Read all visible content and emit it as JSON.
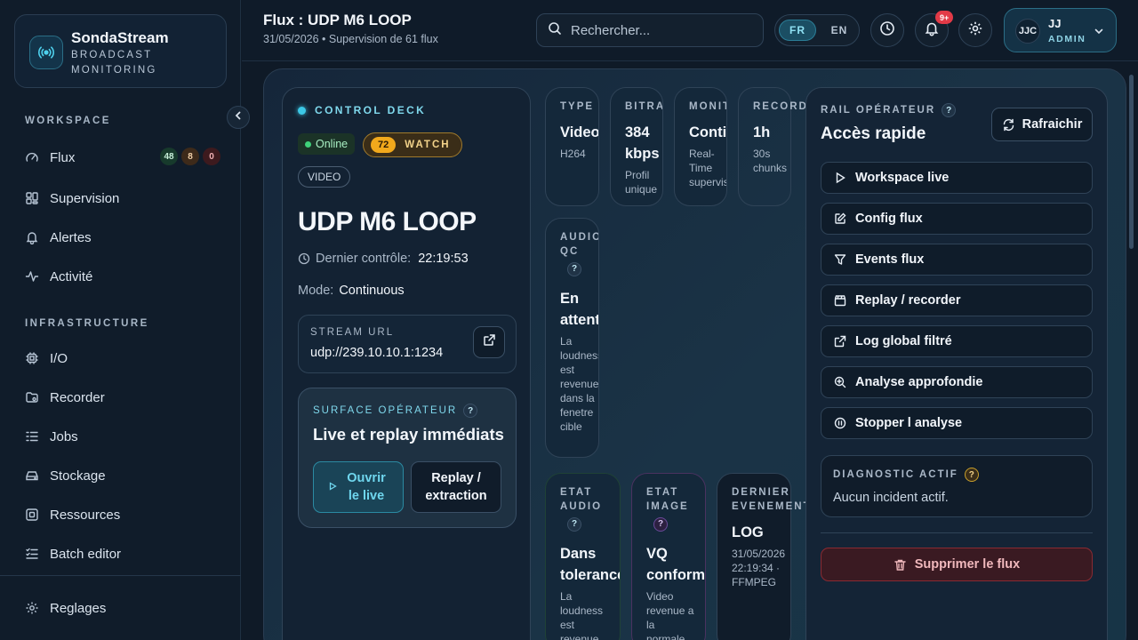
{
  "brand": {
    "name": "SondaStream",
    "subtitle": "BROADCAST MONITORING"
  },
  "sidebar": {
    "workspace_title": "WORKSPACE",
    "infrastructure_title": "INFRASTRUCTURE",
    "workspace_items": [
      {
        "label": "Flux",
        "icon": "gauge-icon"
      },
      {
        "label": "Supervision",
        "icon": "dashboard-icon"
      },
      {
        "label": "Alertes",
        "icon": "bell-icon"
      },
      {
        "label": "Activité",
        "icon": "activity-icon"
      }
    ],
    "flux_badges": {
      "ok": "48",
      "warn": "8",
      "crit": "0"
    },
    "infrastructure_items": [
      {
        "label": "I/O",
        "icon": "chip-icon"
      },
      {
        "label": "Recorder",
        "icon": "folder-icon"
      },
      {
        "label": "Jobs",
        "icon": "list-icon"
      },
      {
        "label": "Stockage",
        "icon": "drive-icon"
      },
      {
        "label": "Ressources",
        "icon": "cpu-icon"
      },
      {
        "label": "Batch editor",
        "icon": "checklist-icon"
      }
    ],
    "settings_label": "Reglages"
  },
  "header": {
    "title": "Flux : UDP M6 LOOP",
    "subtitle": "31/05/2026 • Supervision de 61 flux",
    "search_placeholder": "Rechercher...",
    "lang_active": "FR",
    "lang_other": "EN",
    "notif_badge": "9+",
    "user_initials": "JJC",
    "user_name": "JJ",
    "user_role": "ADMIN"
  },
  "deck": {
    "label": "CONTROL DECK",
    "status": "Online",
    "score": "72",
    "score_label": "WATCH",
    "type_tag": "VIDEO",
    "stream_name": "UDP M6 LOOP",
    "last_check_label": "Dernier contrôle:",
    "last_check_value": "22:19:53",
    "mode_label": "Mode:",
    "mode_value": "Continuous",
    "url_label": "STREAM URL",
    "url_value": "udp://239.10.10.1:1234",
    "surface_label": "SURFACE OPÉRATEUR",
    "surface_title": "Live et replay immédiats",
    "open_live": "Ouvrir le live",
    "replay_extract": "Replay / extraction"
  },
  "metrics": {
    "type": {
      "label": "TYPE",
      "value": "Video",
      "sub": "H264"
    },
    "bitrate": {
      "label": "BITRATE",
      "value": "384 kbps",
      "sub": "Profil unique"
    },
    "monitoring": {
      "label": "MONITORING",
      "value": "Continuous",
      "sub": "Real-Time supervision"
    },
    "recorder": {
      "label": "RECORDER",
      "value": "1h",
      "sub": "30s chunks"
    },
    "audio_qc": {
      "label": "AUDIO QC",
      "value": "En attente",
      "sub": "La loudness est revenue dans la fenetre cible"
    },
    "etat_audio": {
      "label": "ETAT AUDIO",
      "value": "Dans tolerance",
      "sub": "La loudness est revenue"
    },
    "etat_image": {
      "label": "ETAT IMAGE",
      "value": "VQ conforme",
      "sub": "Video revenue a la normale"
    },
    "dernier_evenement": {
      "label": "DERNIER EVENEMENT",
      "value": "LOG",
      "sub": "31/05/2026 22:19:34 · FFMPEG"
    }
  },
  "rail": {
    "label": "RAIL OPÉRATEUR",
    "title": "Accès rapide",
    "refresh": "Rafraichir",
    "actions": [
      {
        "label": "Workspace live",
        "icon": "play-icon"
      },
      {
        "label": "Config flux",
        "icon": "edit-icon"
      },
      {
        "label": "Events flux",
        "icon": "filter-icon"
      },
      {
        "label": "Replay / recorder",
        "icon": "clapper-icon"
      },
      {
        "label": "Log global filtré",
        "icon": "external-link-icon"
      },
      {
        "label": "Analyse approfondie",
        "icon": "zoom-icon"
      },
      {
        "label": "Stopper l analyse",
        "icon": "pause-icon"
      }
    ],
    "diag_label": "DIAGNOSTIC ACTIF",
    "diag_value": "Aucun incident actif.",
    "delete": "Supprimer le flux"
  },
  "colors": {
    "accent": "#3cc8e6",
    "watch": "#f2a91c",
    "online": "#3fd17a",
    "danger": "#e23a47"
  }
}
